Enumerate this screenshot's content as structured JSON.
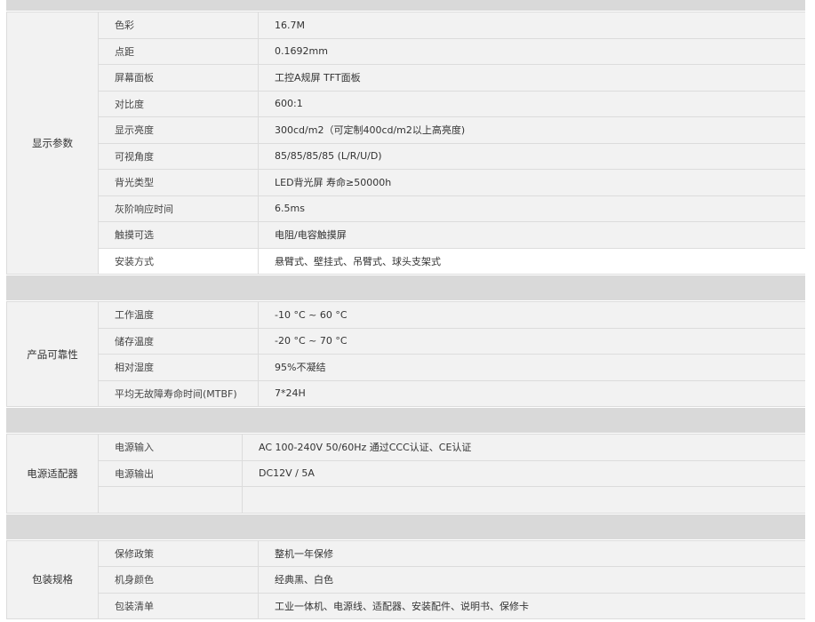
{
  "groups": [
    {
      "title": "显示参数",
      "rows": [
        {
          "key": "色彩",
          "value": "16.7M"
        },
        {
          "key": "点距",
          "value": "0.1692mm"
        },
        {
          "key": "屏幕面板",
          "value": "工控A规屏 TFT面板"
        },
        {
          "key": "对比度",
          "value": "600:1"
        },
        {
          "key": "显示亮度",
          "value": "300cd/m2（可定制400cd/m2以上高亮度)"
        },
        {
          "key": "可视角度",
          "value": "85/85/85/85 (L/R/U/D)"
        },
        {
          "key": "背光类型",
          "value": "LED背光屏 寿命≥50000h"
        },
        {
          "key": "灰阶响应时间",
          "value": "6.5ms"
        },
        {
          "key": "触摸可选",
          "value": "电阻/电容触摸屏"
        },
        {
          "key": "安装方式",
          "value": "悬臂式、壁挂式、吊臂式、球头支架式"
        }
      ]
    },
    {
      "title": "产品可靠性",
      "rows": [
        {
          "key": "工作温度",
          "value": "-10 °C ~ 60 °C"
        },
        {
          "key": "储存温度",
          "value": "-20 °C ~ 70 °C"
        },
        {
          "key": "相对湿度",
          "value": "95%不凝结"
        },
        {
          "key": "平均无故障寿命时间(MTBF)",
          "value": "7*24H"
        }
      ]
    },
    {
      "title": "电源适配器",
      "rows": [
        {
          "key": "电源输入",
          "value": "AC 100-240V  50/60Hz 通过CCC认证、CE认证"
        },
        {
          "key": "电源输出",
          "value": "DC12V / 5A"
        },
        {
          "key": "",
          "value": ""
        }
      ]
    },
    {
      "title": "包装规格",
      "rows": [
        {
          "key": "保修政策",
          "value": "整机一年保修"
        },
        {
          "key": "机身颜色",
          "value": "经典黑、白色"
        },
        {
          "key": "包装清单",
          "value": "工业一体机、电源线、适配器、安装配件、说明书、保修卡"
        }
      ]
    }
  ]
}
